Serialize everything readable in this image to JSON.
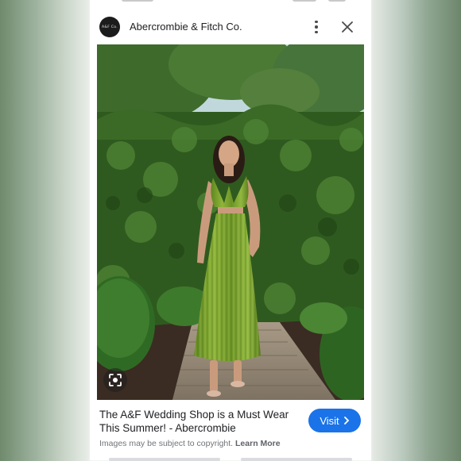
{
  "header": {
    "logo_text": "A&F Co.",
    "site_name": "Abercrombie & Fitch Co.",
    "more_icon": "more-vert-icon",
    "close_icon": "close-icon"
  },
  "image": {
    "lens_icon": "lens-icon"
  },
  "result": {
    "title": "The A&F Wedding Shop is a Must Wear This Summer! - Abercrombie",
    "visit_label": "Visit",
    "visit_icon": "chevron-right-icon",
    "copyright_text": "Images may be subject to copyright.",
    "learn_more_label": "Learn More"
  },
  "colors": {
    "accent": "#1a73e8",
    "dress": "#7a9e2a",
    "foliage": "#2f5a1f"
  }
}
